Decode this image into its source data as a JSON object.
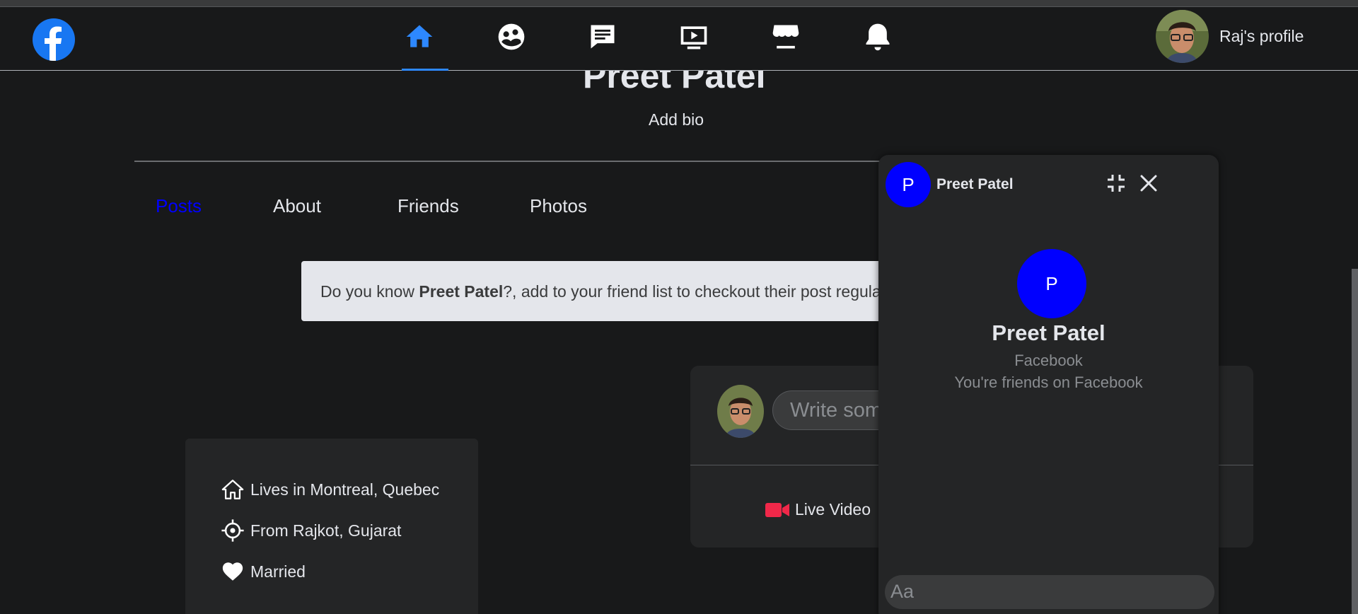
{
  "nav": {
    "items": [
      {
        "icon": "home-icon",
        "active": true
      },
      {
        "icon": "groups-icon",
        "active": false
      },
      {
        "icon": "messages-icon",
        "active": false
      },
      {
        "icon": "watch-icon",
        "active": false
      },
      {
        "icon": "marketplace-icon",
        "active": false
      },
      {
        "icon": "notifications-icon",
        "active": false
      }
    ],
    "profile_label": "Raj's profile",
    "accent": "#2d88ff"
  },
  "profile": {
    "name": "Preet Patel",
    "bio": "Add bio",
    "tabs": [
      "Posts",
      "About",
      "Friends",
      "Photos"
    ],
    "active_tab": "Posts"
  },
  "notice": {
    "prefix": "Do you know ",
    "name": "Preet Patel",
    "suffix": "?, add to your friend list to checkout their post regula"
  },
  "composer": {
    "placeholder": "Write som",
    "live_video_label": "Live Video"
  },
  "intro": {
    "items": [
      {
        "icon": "home-outline-icon",
        "text": "Lives in Montreal, Quebec"
      },
      {
        "icon": "location-icon",
        "text": "From Rajkot, Gujarat"
      },
      {
        "icon": "heart-icon",
        "text": "Married"
      }
    ]
  },
  "chat": {
    "avatar_letter": "P",
    "name": "Preet Patel",
    "platform": "Facebook",
    "friend_status": "You're friends on Facebook",
    "input_placeholder": "Aa",
    "avatar_color": "#0000ff"
  }
}
